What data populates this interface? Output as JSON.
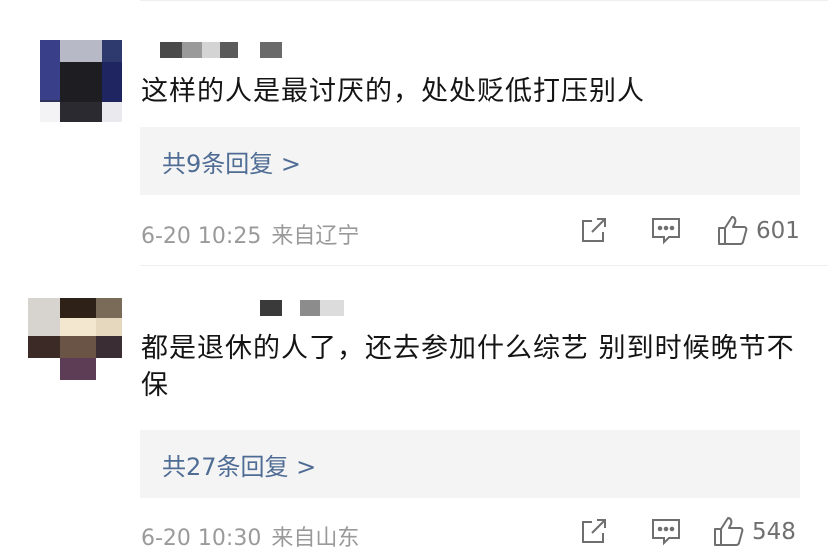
{
  "comments": [
    {
      "text": "这样的人是最讨厌的，处处贬低打压别人",
      "replies": "共9条回复 >",
      "date": "6-20 10:25",
      "location": "来自辽宁",
      "likes": "601"
    },
    {
      "text": "都是退休的人了，还去参加什么综艺  别到时候晚节不保",
      "replies": "共27条回复 >",
      "date": "6-20 10:30",
      "location": "来自山东",
      "likes": "548"
    }
  ],
  "icons": {
    "share": "share-icon",
    "comment": "comment-icon",
    "like": "thumbs-up-icon"
  }
}
